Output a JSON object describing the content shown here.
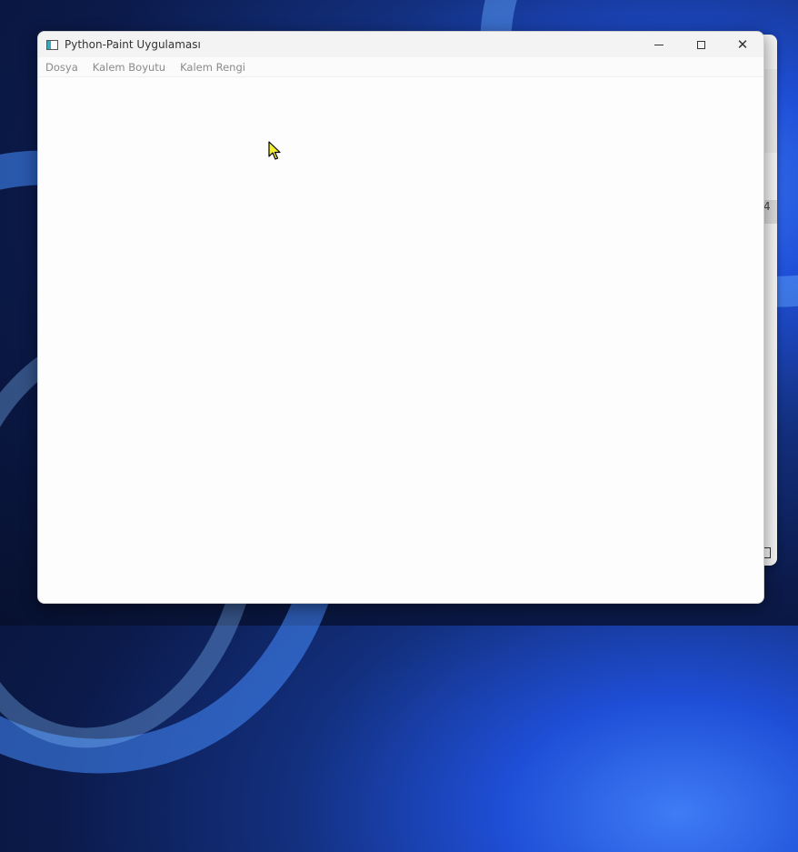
{
  "window": {
    "title": "Python-Paint Uygulaması"
  },
  "menubar": {
    "items": [
      {
        "label": "Dosya"
      },
      {
        "label": "Kalem Boyutu"
      },
      {
        "label": "Kalem Rengi"
      }
    ]
  },
  "background_window": {
    "partial_text": "4"
  },
  "icons": {
    "app": "paint-app-icon",
    "minimize": "minimize-icon",
    "maximize": "maximize-icon",
    "close": "close-icon",
    "cursor": "mouse-cursor-icon"
  },
  "colors": {
    "cursor_fill": "#f5ef2a",
    "desktop_accent": "#1f4fd8"
  }
}
